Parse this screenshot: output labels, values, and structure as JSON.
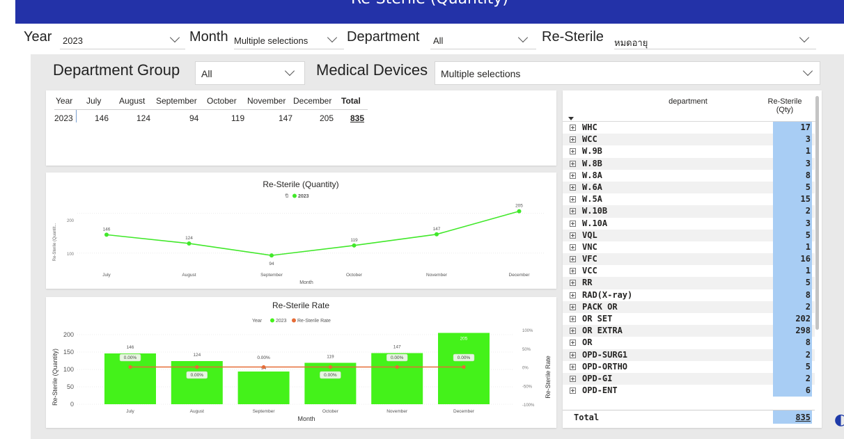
{
  "banner": {
    "title": "Re-Sterile (Quantity)"
  },
  "filters": {
    "year": {
      "label": "Year",
      "value": "2023"
    },
    "month": {
      "label": "Month",
      "value": "Multiple selections"
    },
    "department": {
      "label": "Department",
      "value": "All"
    },
    "resterile": {
      "label": "Re-Sterile",
      "value": "หมดอายุ"
    }
  },
  "subfilters": {
    "group": {
      "label": "Department Group",
      "value": "All"
    },
    "devices": {
      "label": "Medical Devices",
      "value": "Multiple selections"
    }
  },
  "matrix": {
    "headers": [
      "Year",
      "July",
      "August",
      "September",
      "October",
      "November",
      "December",
      "Total"
    ],
    "row": [
      "2023",
      "146",
      "124",
      "94",
      "119",
      "147",
      "205",
      "835"
    ]
  },
  "line_chart": {
    "title": "Re-Sterile (Quantity)",
    "legend_prefix": "ปี",
    "legend_series": "2023",
    "ylabel": "Re-Sterile (Quantit...",
    "xlabel": "Month",
    "y_ticks": [
      "100",
      "200"
    ]
  },
  "bar_chart": {
    "title": "Re-Sterile Rate",
    "legend_year": "Year",
    "legend_series1": "2023",
    "legend_series2": "Re-Sterile Rate",
    "ylabel_left": "Re-Sterile (Quantity)",
    "ylabel_right": "Re-Sterile Rate",
    "xlabel": "Month",
    "y_left_ticks": [
      "0",
      "50",
      "100",
      "150",
      "200"
    ],
    "y_right_ticks": [
      "-100%",
      "-50%",
      "0%",
      "50%",
      "100%"
    ],
    "rate_labels": [
      "0.00%",
      "0.00%",
      "0.00%",
      "0.00%",
      "0.00%",
      "0.00%"
    ]
  },
  "chart_data": [
    {
      "type": "line",
      "title": "Re-Sterile (Quantity)",
      "categories": [
        "July",
        "August",
        "September",
        "October",
        "November",
        "December"
      ],
      "series": [
        {
          "name": "2023",
          "values": [
            146,
            124,
            94,
            119,
            147,
            205
          ],
          "color": "#41e82a"
        }
      ],
      "xlabel": "Month",
      "ylabel": "Re-Sterile (Quantit...",
      "ylim": [
        75,
        220
      ]
    },
    {
      "type": "bar",
      "title": "Re-Sterile Rate",
      "categories": [
        "July",
        "August",
        "September",
        "October",
        "November",
        "December"
      ],
      "series": [
        {
          "name": "2023",
          "values": [
            146,
            124,
            94,
            119,
            147,
            205
          ],
          "color": "#44f21a"
        },
        {
          "name": "Re-Sterile Rate",
          "values": [
            0,
            0,
            0,
            0,
            0,
            0
          ],
          "color": "#e66c37"
        }
      ],
      "xlabel": "Month",
      "ylabel": "Re-Sterile (Quantity)",
      "ylim": [
        0,
        200
      ],
      "y2label": "Re-Sterile Rate",
      "y2lim": [
        -100,
        100
      ]
    }
  ],
  "dept_table": {
    "header_dept": "department",
    "header_qty": "Re-Sterile (Qty)",
    "rows": [
      {
        "name": "WHC",
        "qty": "17"
      },
      {
        "name": "WCC",
        "qty": "3"
      },
      {
        "name": "W.9B",
        "qty": "1"
      },
      {
        "name": "W.8B",
        "qty": "3"
      },
      {
        "name": "W.8A",
        "qty": "8"
      },
      {
        "name": "W.6A",
        "qty": "5"
      },
      {
        "name": "W.5A",
        "qty": "15"
      },
      {
        "name": "W.10B",
        "qty": "2"
      },
      {
        "name": "W.10A",
        "qty": "3"
      },
      {
        "name": "VQL",
        "qty": "5"
      },
      {
        "name": "VNC",
        "qty": "1"
      },
      {
        "name": "VFC",
        "qty": "16"
      },
      {
        "name": "VCC",
        "qty": "1"
      },
      {
        "name": "RR",
        "qty": "5"
      },
      {
        "name": "RAD(X-ray)",
        "qty": "8"
      },
      {
        "name": "PACK OR",
        "qty": "2"
      },
      {
        "name": "OR SET",
        "qty": "202"
      },
      {
        "name": "OR EXTRA",
        "qty": "298"
      },
      {
        "name": "OR",
        "qty": "8"
      },
      {
        "name": "OPD-SURG1",
        "qty": "2"
      },
      {
        "name": "OPD-ORTHO",
        "qty": "5"
      },
      {
        "name": "OPD-GI",
        "qty": "2"
      },
      {
        "name": "OPD-ENT",
        "qty": "6"
      }
    ],
    "total_label": "Total",
    "total_value": "835"
  },
  "colors": {
    "banner": "#2332a8",
    "series": "#41e82a",
    "rate": "#e66c37",
    "qty_cell": "#a8cdf4"
  }
}
